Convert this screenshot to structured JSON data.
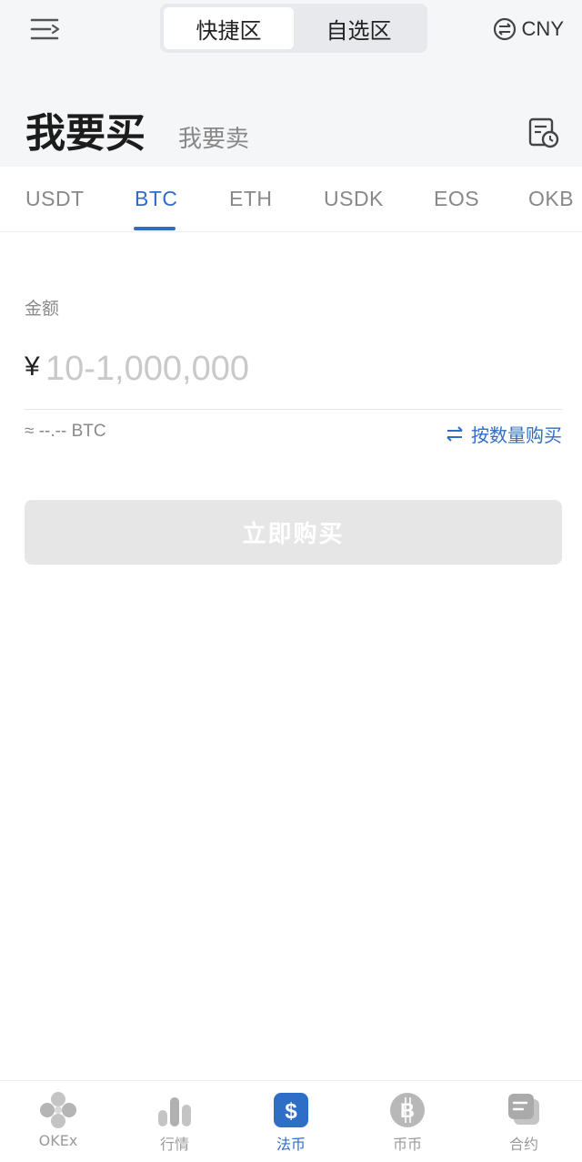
{
  "header": {
    "segments": [
      {
        "label": "快捷区",
        "active": true
      },
      {
        "label": "自选区",
        "active": false
      }
    ],
    "currency": "CNY"
  },
  "mode": {
    "buy_label": "我要买",
    "sell_label": "我要卖"
  },
  "coin_tabs": [
    {
      "label": "USDT",
      "active": false
    },
    {
      "label": "BTC",
      "active": true
    },
    {
      "label": "ETH",
      "active": false
    },
    {
      "label": "USDK",
      "active": false
    },
    {
      "label": "EOS",
      "active": false
    },
    {
      "label": "OKB",
      "active": false
    }
  ],
  "form": {
    "amount_label": "金额",
    "currency_symbol": "¥",
    "amount_placeholder": "10-1,000,000",
    "approx_text": "≈ --.-- BTC",
    "switch_label": "按数量购买",
    "buy_button": "立即购买"
  },
  "bottom_nav": [
    {
      "label": "OKEx",
      "icon": "okex-logo-icon",
      "active": false
    },
    {
      "label": "行情",
      "icon": "bar-chart-icon",
      "active": false
    },
    {
      "label": "法币",
      "icon": "dollar-icon",
      "active": true
    },
    {
      "label": "币币",
      "icon": "bitcoin-icon",
      "active": false
    },
    {
      "label": "合约",
      "icon": "contract-icon",
      "active": false
    }
  ],
  "colors": {
    "accent": "#2e6ec7",
    "header_bg": "#f5f6f8",
    "disabled_button": "#e6e6e6"
  }
}
